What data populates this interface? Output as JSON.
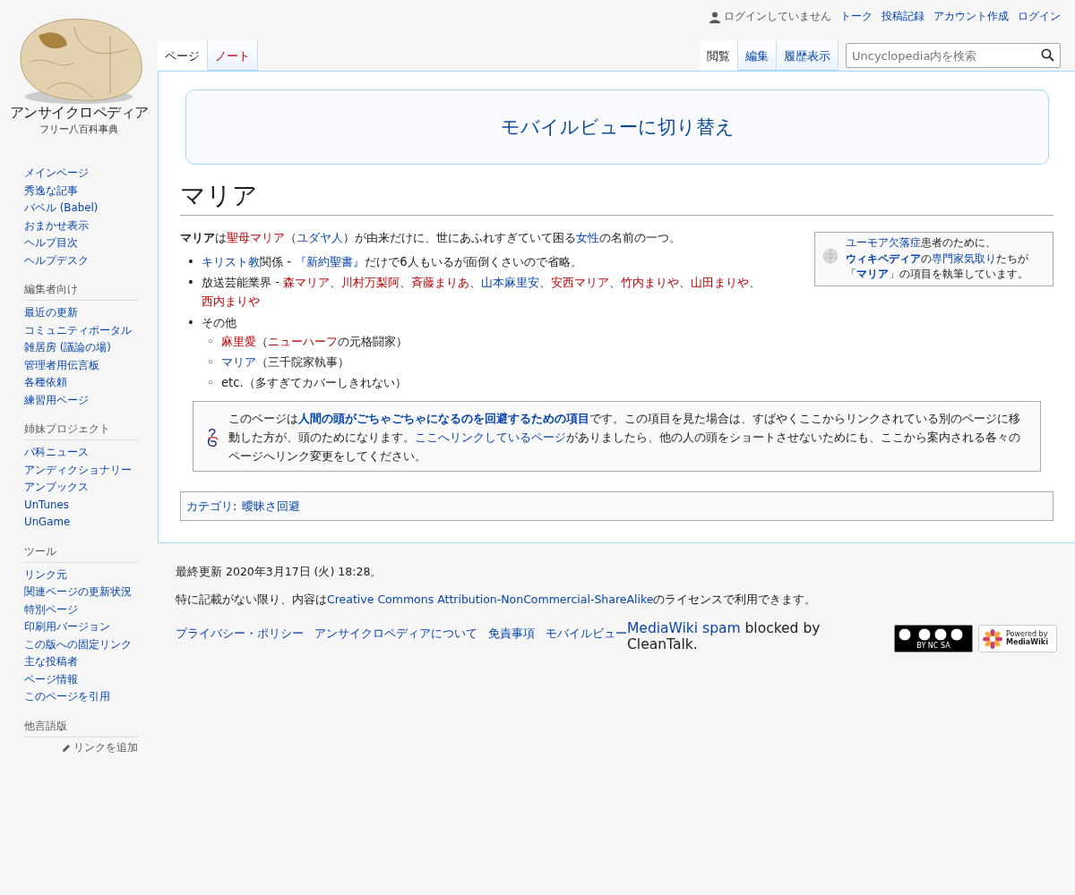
{
  "logo": {
    "title": "アンサイクロペディア",
    "tagline": "フリー八百科事典"
  },
  "personal": {
    "status": "ログインしていません",
    "links": [
      "トーク",
      "投稿記録",
      "アカウント作成",
      "ログイン"
    ]
  },
  "left_tabs": [
    {
      "label": "ページ",
      "selected": true,
      "missing": false
    },
    {
      "label": "ノート",
      "selected": false,
      "missing": true
    }
  ],
  "right_tabs": [
    {
      "label": "閲覧",
      "selected": true
    },
    {
      "label": "編集",
      "selected": false
    },
    {
      "label": "履歴表示",
      "selected": false
    }
  ],
  "search": {
    "placeholder": "Uncyclopedia内を検索"
  },
  "sidebar": [
    {
      "items": [
        "メインページ",
        "秀逸な記事",
        "バベル (Babel)",
        "おまかせ表示",
        "ヘルプ目次",
        "ヘルプデスク"
      ]
    },
    {
      "heading": "編集者向け",
      "items": [
        "最近の更新",
        "コミュニティポータル",
        "雑居房 (議論の場)",
        "管理者用伝言板",
        "各種依頼",
        "練習用ページ"
      ]
    },
    {
      "heading": "姉妹プロジェクト",
      "items": [
        "バ科ニュース",
        "アンディクショナリー",
        "アンブックス",
        "UnTunes",
        "UnGame"
      ]
    },
    {
      "heading": "ツール",
      "items": [
        "リンク元",
        "関連ページの更新状況",
        "特別ページ",
        "印刷用バージョン",
        "この版への固定リンク",
        "主な投稿者",
        "ページ情報",
        "このページを引用"
      ]
    },
    {
      "heading": "他言語版",
      "action": "リンクを追加"
    }
  ],
  "mobile_switch": "モバイルビューに切り替え",
  "title": "マリア",
  "sidebox": [
    {
      "text": "ユーモア欠落症",
      "kind": "link"
    },
    {
      "text": "患者のために、",
      "kind": "plain"
    },
    {
      "text": "ウィキペディア",
      "kind": "link",
      "bold": true
    },
    {
      "text": "の",
      "kind": "plain"
    },
    {
      "text": "専門家気取り",
      "kind": "link"
    },
    {
      "text": "たちが「",
      "kind": "plain"
    },
    {
      "text": "マリア",
      "kind": "link",
      "bold": true
    },
    {
      "text": "」の項目を執筆しています。",
      "kind": "plain"
    }
  ],
  "intro": [
    {
      "text": "マリア",
      "kind": "plain",
      "bold": true
    },
    {
      "text": "は",
      "kind": "plain"
    },
    {
      "text": "聖母マリア",
      "kind": "new"
    },
    {
      "text": "（",
      "kind": "plain"
    },
    {
      "text": "ユダヤ人",
      "kind": "link"
    },
    {
      "text": "）が由来だけに、世にあふれすぎていて困る",
      "kind": "plain"
    },
    {
      "text": "女性",
      "kind": "link"
    },
    {
      "text": "の名前の一つ。",
      "kind": "plain"
    }
  ],
  "list": [
    {
      "marker": "•",
      "segments": [
        {
          "text": "キリスト教",
          "kind": "link"
        },
        {
          "text": "関係 - ",
          "kind": "plain"
        },
        {
          "text": "『新約聖書』",
          "kind": "link"
        },
        {
          "text": "だけで6人もいるが面倒くさいので省略。",
          "kind": "plain"
        }
      ]
    },
    {
      "marker": "•",
      "segments": [
        {
          "text": "放送芸能業界 - ",
          "kind": "plain"
        },
        {
          "text": "森マリア",
          "kind": "new"
        },
        {
          "text": "、",
          "kind": "plain"
        },
        {
          "text": "川村万梨阿",
          "kind": "new"
        },
        {
          "text": "、",
          "kind": "plain"
        },
        {
          "text": "斉藤まりあ",
          "kind": "new"
        },
        {
          "text": "、",
          "kind": "plain"
        },
        {
          "text": "山本麻里安",
          "kind": "link"
        },
        {
          "text": "、",
          "kind": "plain"
        },
        {
          "text": "安西マリア",
          "kind": "new"
        },
        {
          "text": "、",
          "kind": "plain"
        },
        {
          "text": "竹内まりや",
          "kind": "new"
        },
        {
          "text": "、",
          "kind": "plain"
        },
        {
          "text": "山田まりや",
          "kind": "new"
        },
        {
          "text": "、",
          "kind": "plain"
        },
        {
          "text": "西内まりや",
          "kind": "new"
        }
      ]
    },
    {
      "marker": "•",
      "segments": [
        {
          "text": "その他",
          "kind": "plain"
        }
      ],
      "children": [
        {
          "marker": "◦",
          "segments": [
            {
              "text": "麻里愛",
              "kind": "new"
            },
            {
              "text": "（",
              "kind": "plain"
            },
            {
              "text": "ニューハーフ",
              "kind": "new"
            },
            {
              "text": "の元格闘家）",
              "kind": "plain"
            }
          ]
        },
        {
          "marker": "◦",
          "segments": [
            {
              "text": "マリア",
              "kind": "link"
            },
            {
              "text": "（三千院家執事）",
              "kind": "plain"
            }
          ]
        },
        {
          "marker": "◦",
          "segments": [
            {
              "text": "etc.（多すぎてカバーしきれない）",
              "kind": "plain"
            }
          ]
        }
      ]
    }
  ],
  "notice": [
    {
      "text": "このページは",
      "kind": "plain"
    },
    {
      "text": "人間の頭がごちゃごちゃになるのを回避するための項目",
      "kind": "link",
      "bold": true
    },
    {
      "text": "です。この項目を見た場合は、すばやくここからリンクされている別のページに移動した方が、頭のためになります。",
      "kind": "plain"
    },
    {
      "text": "ここへリンクしているページ",
      "kind": "link"
    },
    {
      "text": "がありましたら、他の人の頭をショートさせないためにも、ここから案内される各々のページへリンク変更をしてください。",
      "kind": "plain"
    }
  ],
  "categories": {
    "label": "カテゴリ",
    "separator": ":",
    "items": [
      "曖昧さ回避"
    ]
  },
  "footer": {
    "last_modified": "最終更新 2020年3月17日 (火) 18:28。",
    "license": [
      {
        "text": "特に記載がない限り、内容は",
        "kind": "plain"
      },
      {
        "text": "Creative Commons Attribution-NonCommercial-ShareAlike",
        "kind": "link"
      },
      {
        "text": "のライセンスで利用できます。",
        "kind": "plain"
      }
    ],
    "links": [
      "プライバシー・ポリシー",
      "アンサイクロペディアについて",
      "免責事項",
      "モバイルビュー"
    ],
    "cleantalk": [
      {
        "text": "MediaWiki spam",
        "kind": "link"
      },
      {
        "text": " blocked by CleanTalk.",
        "kind": "plain"
      }
    ],
    "license_badge": "BY NC SA",
    "powered": [
      "Powered by",
      "MediaWiki"
    ]
  }
}
